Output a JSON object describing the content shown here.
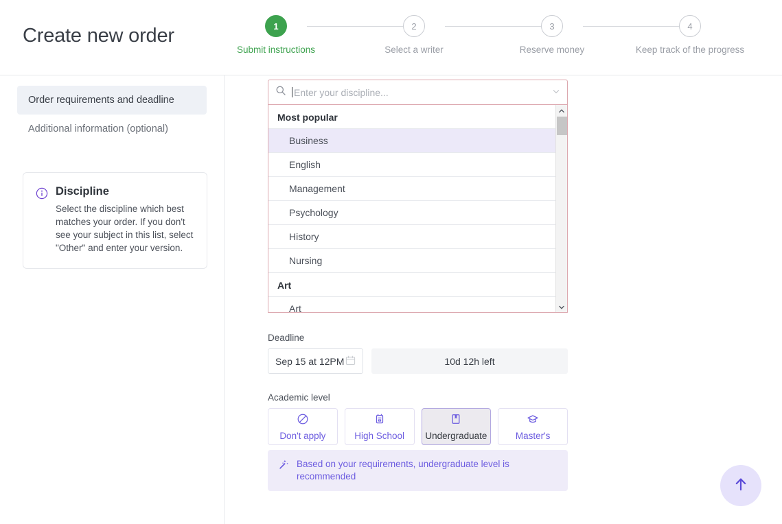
{
  "header": {
    "title": "Create new order",
    "steps": [
      {
        "number": "1",
        "label": "Submit instructions",
        "state": "active"
      },
      {
        "number": "2",
        "label": "Select a writer",
        "state": "inactive"
      },
      {
        "number": "3",
        "label": "Reserve money",
        "state": "inactive"
      },
      {
        "number": "4",
        "label": "Keep track of the progress",
        "state": "inactive"
      }
    ]
  },
  "sidebar": {
    "items": [
      {
        "label": "Order requirements and deadline",
        "active": true
      },
      {
        "label": "Additional information (optional)",
        "active": false
      }
    ],
    "info_card": {
      "icon": "info-circle-icon",
      "title": "Discipline",
      "text": "Select the discipline which best matches your order. If you don't see your subject in this list, select \"Other\" and enter your version."
    }
  },
  "discipline": {
    "search_icon": "search-icon",
    "placeholder": "Enter your discipline...",
    "value": "",
    "chevron_icon": "chevron-down-icon",
    "groups": [
      {
        "label": "Most popular",
        "options": [
          {
            "label": "Business",
            "selected": true
          },
          {
            "label": "English",
            "selected": false
          },
          {
            "label": "Management",
            "selected": false
          },
          {
            "label": "Psychology",
            "selected": false
          },
          {
            "label": "History",
            "selected": false
          },
          {
            "label": "Nursing",
            "selected": false
          }
        ]
      },
      {
        "label": "Art",
        "options": [
          {
            "label": "Art",
            "selected": false
          }
        ]
      }
    ]
  },
  "deadline": {
    "label": "Deadline",
    "date_value": "Sep 15 at 12PM",
    "calendar_icon": "calendar-icon",
    "time_left": "10d 12h left"
  },
  "academic_level": {
    "label": "Academic level",
    "options": [
      {
        "label": "Don't apply",
        "icon": "no-entry-icon",
        "selected": false
      },
      {
        "label": "High School",
        "icon": "backpack-icon",
        "selected": false
      },
      {
        "label": "Undergraduate",
        "icon": "book-bookmark-icon",
        "selected": true
      },
      {
        "label": "Master's",
        "icon": "graduation-cap-icon",
        "selected": false
      }
    ]
  },
  "recommendation": {
    "icon": "magic-wand-icon",
    "text": "Based on your requirements, undergraduate level is recommended"
  },
  "scroll_top_button": {
    "icon": "arrow-up-icon"
  },
  "colors": {
    "accent_green": "#3da24e",
    "accent_purple": "#6c5ce0",
    "error_border": "#dca7ae",
    "selected_option_bg": "#ece9f9",
    "banner_bg": "#efecf9",
    "sidebar_active_bg": "#eef1f6"
  }
}
